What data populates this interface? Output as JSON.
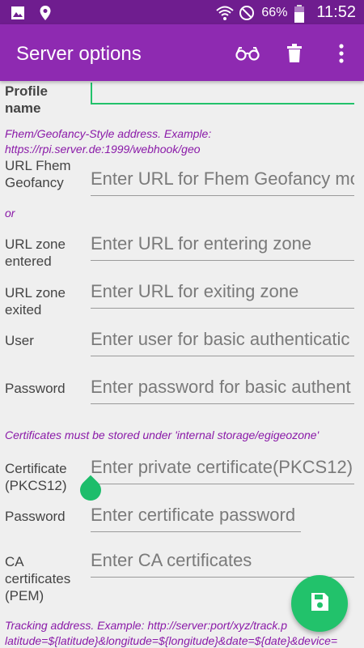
{
  "status_bar": {
    "battery": "66%",
    "time": "11:52"
  },
  "appbar": {
    "title": "Server options"
  },
  "form": {
    "profile_label": "Profile\nname",
    "profile_value": "",
    "hint_address": "Fhem/Geofancy-Style address. Example: https://rpi.server.de:1999/webhook/geo",
    "url_fhem_label": "URL Fhem Geofancy",
    "url_fhem_placeholder": "Enter URL for Fhem Geofancy mo",
    "or_text": "or",
    "url_enter_label": "URL zone entered",
    "url_enter_placeholder": "Enter URL for entering zone",
    "url_exit_label": "URL zone exited",
    "url_exit_placeholder": "Enter URL for exiting zone",
    "user_label": "User",
    "user_placeholder": "Enter user for basic authenticatic",
    "password_label": "Password",
    "password_placeholder": "Enter password for basic authent",
    "hint_certs": "Certificates must be stored under 'internal storage/egigeozone'",
    "cert_label": "Certificate (PKCS12)",
    "cert_placeholder": "Enter private certificate(PKCS12)",
    "cert_password_label": "Password",
    "cert_password_placeholder": "Enter certificate password",
    "ca_label": "CA certificates (PEM)",
    "ca_placeholder": "Enter CA certificates",
    "hint_tracking": "Tracking address. Example: http://server:port/xyz/track.p latitude=${latitude}&longitude=${longitude}&date=${date}&device="
  },
  "colors": {
    "status_bar": "#6f1d8f",
    "app_bar": "#8e2ab1",
    "accent": "#22c26b",
    "hint": "#8a1aa8"
  },
  "icons": [
    "image-icon",
    "location-icon",
    "wifi-icon",
    "do-not-disturb-icon",
    "battery-icon",
    "glasses-icon",
    "delete-icon",
    "more-vert-icon",
    "save-icon"
  ]
}
